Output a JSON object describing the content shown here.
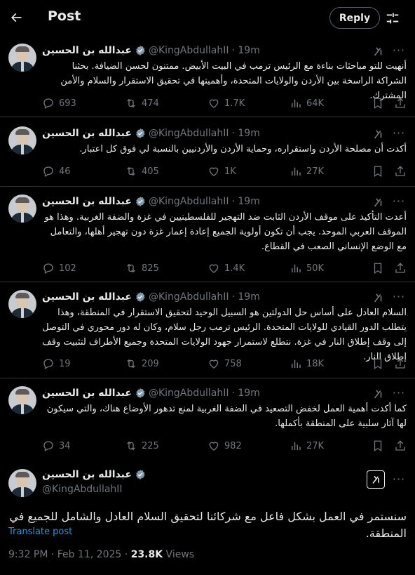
{
  "header": {
    "title": "Post",
    "reply_label": "Reply"
  },
  "author": {
    "name": "عبدالله بن الحسين",
    "handle": "@KingAbdullahII"
  },
  "tweets": [
    {
      "time": "· 19m",
      "text": "أنهيت للتو مباحثات بناءة مع الرئيس ترمب في البيت الأبيض. ممتنون لحسن الضيافة. بحثنا الشراكة الراسخة بين الأردن والولايات المتحدة، وأهميتها في تحقيق الاستقرار والسلام والأمن المشترك.",
      "replies": "693",
      "reposts": "474",
      "likes": "1.7K",
      "views": "64K"
    },
    {
      "time": "· 19m",
      "text": "أكدت أن مصلحة الأردن واستقراره، وحماية الأردن والأردنيين بالنسبة لي فوق كل اعتبار.",
      "replies": "46",
      "reposts": "405",
      "likes": "1K",
      "views": "27K"
    },
    {
      "time": "· 19m",
      "text": "أعدت التأكيد على موقف الأردن الثابت ضد التهجير للفلسطينيين في غزة والضفة الغربية. وهذا هو الموقف العربي الموحد. يجب أن تكون أولوية الجميع إعادة إعمار غزة دون تهجير أهلها، والتعامل مع الوضع الإنساني الصعب في القطاع.",
      "replies": "102",
      "reposts": "825",
      "likes": "1.4K",
      "views": "50K"
    },
    {
      "time": "· 19m",
      "text": "السلام العادل على أساس حل الدولتين هو السبيل الوحيد لتحقيق الاستقرار في المنطقة، وهذا يتطلب الدور القيادي للولايات المتحدة. الرئيس ترمب رجل سلام، وكان له دور محوري في التوصل إلى وقف إطلاق النار في غزة. نتطلع لاستمرار جهود الولايات المتحدة وجميع الأطراف لتثبيت وقف إطلاق النار.",
      "replies": "19",
      "reposts": "209",
      "likes": "758",
      "views": "18K"
    },
    {
      "time": "· 19m",
      "text": "كما أكدت أهمية العمل لخفض التصعيد في الضفة الغربية لمنع تدهور الأوضاع هناك، والتي سيكون لها آثار سلبية على المنطقة بأكملها.",
      "replies": "34",
      "reposts": "225",
      "likes": "982",
      "views": "27K"
    }
  ],
  "main_tweet": {
    "text": "سنستمر في العمل بشكل فاعل مع شركائنا لتحقيق السلام العادل والشامل للجميع في المنطقة.",
    "translate_label": "Translate post",
    "timestamp": "9:32 PM · Feb 11, 2025 · ",
    "views_count": "23.8K",
    "views_label": " Views"
  },
  "colors": {
    "background": "#000000",
    "text": "#e7e9ea",
    "muted": "#71767b",
    "accent": "#1d9bf0",
    "verified": "#829aab"
  },
  "icons": [
    "back-arrow-icon",
    "tune-icon",
    "verified-badge-icon",
    "grok-icon",
    "more-icon",
    "reply-icon",
    "repost-icon",
    "like-icon",
    "views-icon",
    "bookmark-icon",
    "share-icon"
  ]
}
